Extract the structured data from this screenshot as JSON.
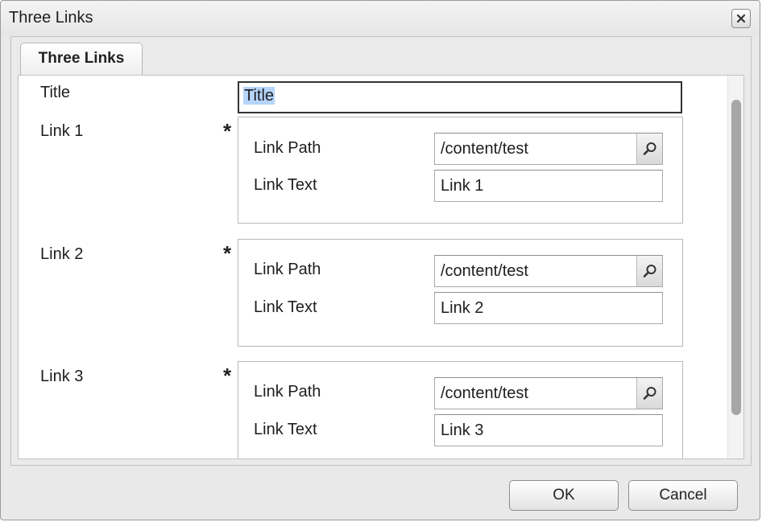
{
  "window": {
    "title": "Three Links"
  },
  "tabs": [
    {
      "label": "Three Links"
    }
  ],
  "form": {
    "title_label": "Title",
    "title_value": "Title",
    "required_marker": "*",
    "links": [
      {
        "label": "Link 1",
        "path_label": "Link Path",
        "path_value": "/content/test",
        "text_label": "Link Text",
        "text_value": "Link 1"
      },
      {
        "label": "Link 2",
        "path_label": "Link Path",
        "path_value": "/content/test",
        "text_label": "Link Text",
        "text_value": "Link 2"
      },
      {
        "label": "Link 3",
        "path_label": "Link Path",
        "path_value": "/content/test",
        "text_label": "Link Text",
        "text_value": "Link 3"
      }
    ]
  },
  "footer": {
    "ok_label": "OK",
    "cancel_label": "Cancel"
  },
  "icons": {
    "close": "close-icon",
    "search": "search-icon"
  },
  "colors": {
    "selection": "#b6d5fb",
    "scrollbar_thumb": "#a6a6a6"
  }
}
